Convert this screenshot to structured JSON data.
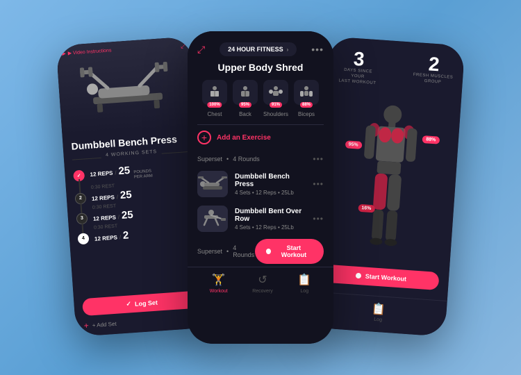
{
  "background": "#6ba3cc",
  "phones": {
    "left": {
      "videoLabel": "▶ Video Instructions",
      "exerciseTitle": "Dumbbell Bench Press",
      "setsLabel": "4 WORKING SETS",
      "poundsLabel": "POUNDS\nPER ARM",
      "sets": [
        {
          "num": 1,
          "reps": "12 REPS",
          "weight": "25",
          "rest": "0:30 REST",
          "completed": true
        },
        {
          "num": 2,
          "reps": "12 REPS",
          "weight": "25",
          "rest": "0:30 REST",
          "completed": false
        },
        {
          "num": 3,
          "reps": "12 REPS",
          "weight": "25",
          "rest": "0:30 REST",
          "completed": false
        },
        {
          "num": 4,
          "reps": "12 REPS",
          "weight": "2",
          "rest": "",
          "completed": false
        }
      ],
      "logBtn": "Log Set",
      "addSet": "+ Add Set"
    },
    "center": {
      "gymName": "24 HOUR FITNESS",
      "workoutTitle": "Upper Body Shred",
      "muscleGroups": [
        {
          "name": "Chest",
          "pct": "100%"
        },
        {
          "name": "Back",
          "pct": "95%"
        },
        {
          "name": "Shoulders",
          "pct": "91%"
        },
        {
          "name": "Biceps",
          "pct": "88%"
        }
      ],
      "addExercise": "Add an Exercise",
      "superset1": {
        "label": "Superset",
        "rounds": "4 Rounds",
        "exercises": [
          {
            "name": "Dumbbell Bench Press",
            "meta": "4 Sets • 12 Reps • 25Lb"
          },
          {
            "name": "Dumbbell Bent Over Row",
            "meta": "4 Sets • 12 Reps • 25Lb"
          }
        ]
      },
      "superset2": {
        "label": "Superset",
        "rounds": "4 Rounds"
      },
      "startWorkout": "Start Workout",
      "nav": [
        {
          "icon": "🏋",
          "label": "Workout",
          "active": true
        },
        {
          "icon": "⟳",
          "label": "Recovery",
          "active": false
        },
        {
          "icon": "📋",
          "label": "Log",
          "active": false
        }
      ]
    },
    "right": {
      "daysStat": "3",
      "daysLabel": "DAYS SINCE YOUR\nLAST WORKOUT",
      "freshStat": "2",
      "freshLabel": "FRESH MUSCLES\nGROUP",
      "chestPct": "95%",
      "shoulderPct": "88%",
      "quadPct": "16%",
      "startWorkout": "Start Workout",
      "navIcon": "📋",
      "navLabel": "Log"
    }
  }
}
